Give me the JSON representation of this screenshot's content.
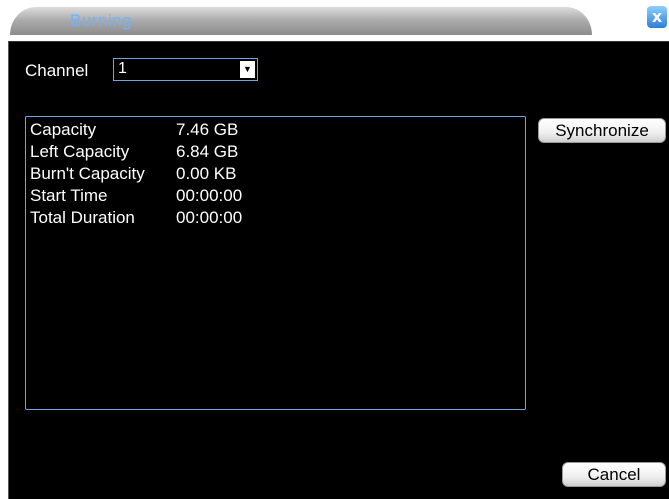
{
  "window": {
    "title": "Burning",
    "close_glyph": "x"
  },
  "channel": {
    "label": "Channel",
    "value": "1"
  },
  "info": [
    {
      "key": "Capacity",
      "value": "7.46 GB"
    },
    {
      "key": "Left Capacity",
      "value": "6.84 GB"
    },
    {
      "key": "Burn't Capacity",
      "value": "0.00 KB"
    },
    {
      "key": "Start Time",
      "value": "00:00:00"
    },
    {
      "key": "Total Duration",
      "value": "00:00:00"
    }
  ],
  "buttons": {
    "synchronize": "Synchronize",
    "cancel": "Cancel"
  },
  "colors": {
    "title_text": "#6fb3ff",
    "panel_bg": "#000000",
    "border_accent": "#6aa6e8"
  }
}
